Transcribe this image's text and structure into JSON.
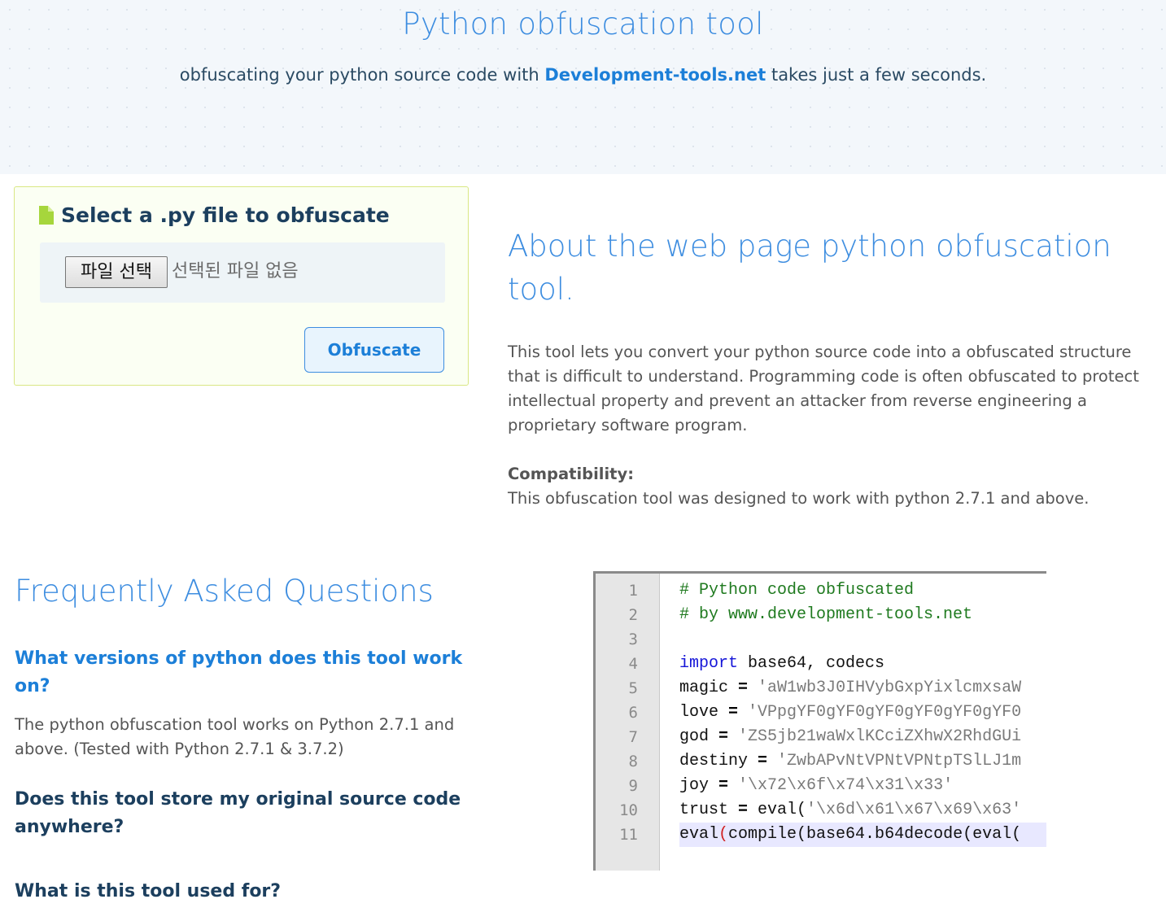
{
  "hero": {
    "title": "Python obfuscation tool",
    "subtitle_before": "obfuscating your python source code with ",
    "brand_link": "Development-tools.net",
    "subtitle_after": " takes just a few seconds."
  },
  "upload": {
    "heading": "Select a .py file to obfuscate",
    "file_button_label": "파일 선택",
    "file_status": "선택된 파일 없음",
    "submit_label": "Obfuscate",
    "icon": "file-icon"
  },
  "about": {
    "title": "About the web page python obfuscation tool.",
    "body": "This tool lets you convert your python source code into a obfuscated structure that is difficult to understand. Programming code is often obfuscated to protect intellectual property and prevent an attacker from reverse engineering a proprietary software program.",
    "compat_label": "Compatibility:",
    "compat_text": "This obfuscation tool was designed to work with python 2.7.1 and above."
  },
  "faq": {
    "title": "Frequently Asked Questions",
    "items": [
      {
        "question": "What versions of python does this tool work on?",
        "answer": "The python obfuscation tool works on Python 2.7.1 and above. (Tested with Python 2.7.1 & 3.7.2)"
      },
      {
        "question": "Does this tool store my original source code anywhere?"
      },
      {
        "question": "What is this tool used for?"
      }
    ]
  },
  "code_sample": {
    "line_numbers": [
      "1",
      "2",
      "3",
      "4",
      "5",
      "6",
      "7",
      "8",
      "9",
      "10",
      "11"
    ],
    "lines": [
      "# Python code obfuscated",
      "# by www.development-tools.net",
      "",
      "import base64, codecs",
      "magic = 'aW1wb3J0IHVybGxpYixlcmxsaW",
      "love = 'VPpgYF0gYF0gYF0gYF0gYF0gYF0",
      "god = 'ZS5jb21waWxlKCciZXhwX2RhdGUi",
      "destiny = 'ZwbAPvNtVPNtVPNtpTSlLJ1m",
      "joy = '\\x72\\x6f\\x74\\x31\\x33'",
      "trust = eval('\\x6d\\x61\\x67\\x69\\x63'",
      "eval(compile(base64.b64decode(eval("
    ]
  },
  "colors": {
    "accent": "#3d8de0",
    "link": "#1c7fd8",
    "heading_dark": "#1c3f5e",
    "upload_bg": "#fbfff3",
    "upload_border": "#d9e784",
    "file_icon": "#a6d63c"
  }
}
